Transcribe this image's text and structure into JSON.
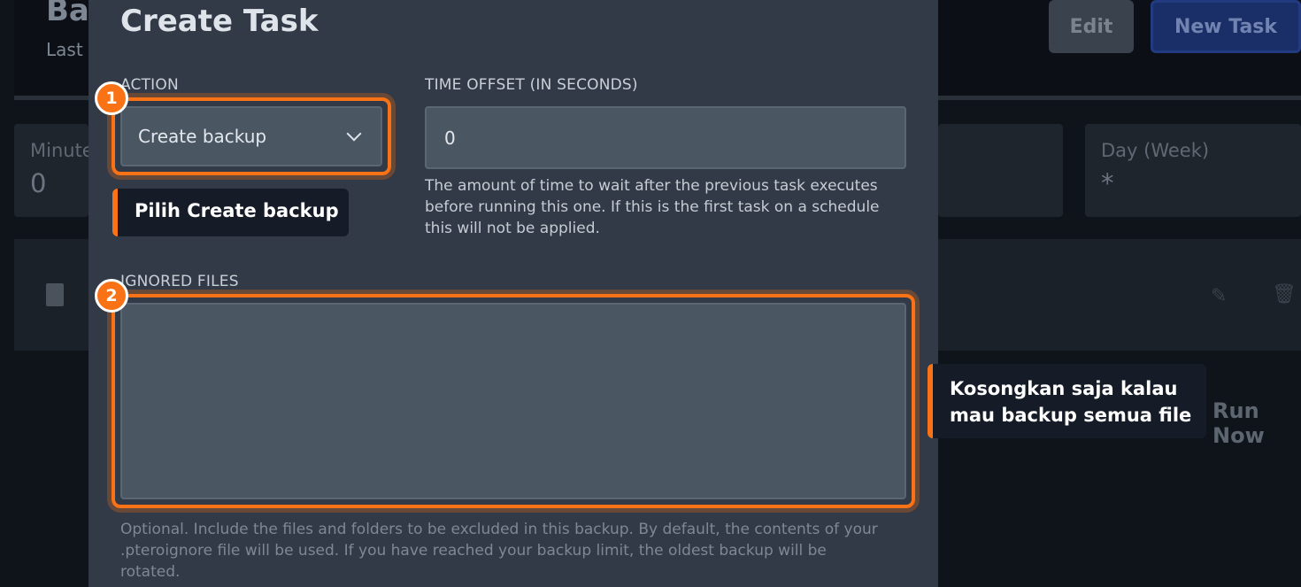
{
  "background": {
    "title": "Backup",
    "subtitle": "Last",
    "edit_label": "Edit",
    "new_task_label": "New Task",
    "cards": {
      "minute": {
        "label": "Minute",
        "value": "0"
      },
      "day_week": {
        "label": "Day (Week)",
        "value": "*"
      }
    },
    "run_now_label": "Run Now",
    "icons": {
      "file": "file-archive-icon",
      "edit": "pencil-icon",
      "delete": "trash-icon"
    }
  },
  "modal": {
    "title": "Create Task",
    "action": {
      "label": "ACTION",
      "value": "Create backup"
    },
    "time_offset": {
      "label": "TIME OFFSET (IN SECONDS)",
      "value": "0",
      "help_lines": [
        "The amount of time to wait after the previous task executes",
        "before running this one. If this is the first task on a schedule",
        "this will not be applied."
      ]
    },
    "ignored_files": {
      "label": "IGNORED FILES",
      "value": "",
      "help_lines": [
        "Optional. Include the files and folders to be excluded in this backup. By default, the contents of your",
        ".pteroignore file will be used. If you have reached your backup limit, the oldest backup will be",
        "rotated."
      ]
    }
  },
  "annotations": {
    "step1": {
      "number": "1",
      "text": "Pilih Create backup"
    },
    "step2": {
      "number": "2",
      "text_lines": [
        "Kosongkan saja kalau",
        "mau backup semua file"
      ]
    }
  },
  "colors": {
    "accent": "#f97316",
    "modal_bg": "#313a46",
    "field_bg": "#4b5663",
    "primary": "#1a2f68"
  }
}
